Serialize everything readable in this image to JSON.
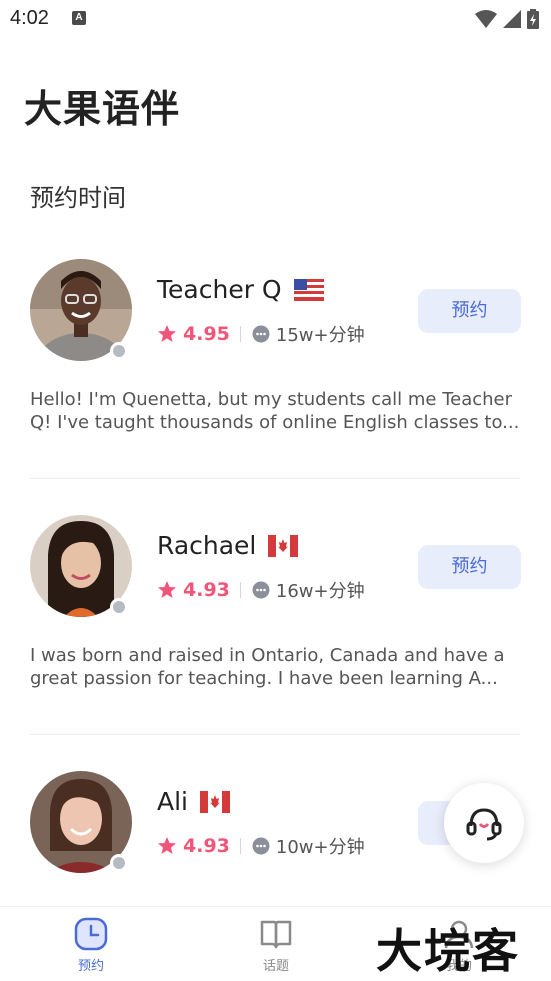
{
  "status_bar": {
    "time": "4:02",
    "notification_badge": "A"
  },
  "app": {
    "title": "大果语伴"
  },
  "section": {
    "title": "预约时间"
  },
  "teachers": [
    {
      "name": "Teacher Q",
      "flag": "us-flag",
      "rating": "4.95",
      "minutes": "15w+分钟",
      "book_label": "预约",
      "description": "Hello! I'm Quenetta, but my students call me Teacher Q! I've taught thousands of online English classes to..."
    },
    {
      "name": "Rachael",
      "flag": "canada-flag",
      "rating": "4.93",
      "minutes": "16w+分钟",
      "book_label": "预约",
      "description": "I was born and raised in Ontario, Canada and have a great passion for teaching. I have been learning A..."
    },
    {
      "name": "Ali",
      "flag": "canada-flag",
      "rating": "4.93",
      "minutes": "10w+分钟",
      "book_label": "预约",
      "description": ""
    }
  ],
  "tabs": [
    {
      "label": "预约",
      "icon": "clock-icon",
      "active": true
    },
    {
      "label": "话题",
      "icon": "book-icon",
      "active": false
    },
    {
      "label": "我的",
      "icon": "user-icon",
      "active": false
    }
  ],
  "watermark": "大垸客",
  "colors": {
    "accent": "#4a6ad6",
    "rating": "#f0567a",
    "button_bg": "#e8edfb"
  }
}
